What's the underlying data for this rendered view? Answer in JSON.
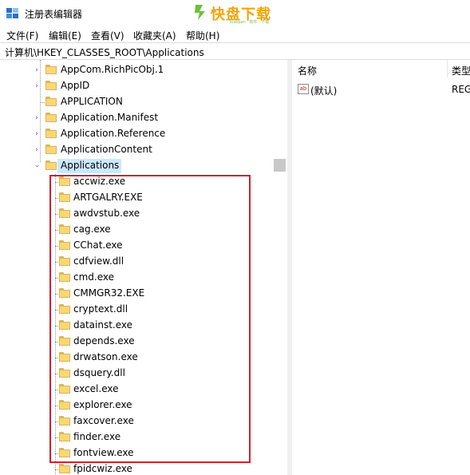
{
  "window": {
    "title": "注册表编辑器",
    "app_icon": "registry-editor-icon"
  },
  "watermark": {
    "text": "快盘下载",
    "subtitle": "kuaipan · 软件 · 下载"
  },
  "menu": [
    {
      "label": "文件(F)"
    },
    {
      "label": "编辑(E)"
    },
    {
      "label": "查看(V)"
    },
    {
      "label": "收藏夹(A)"
    },
    {
      "label": "帮助(H)"
    }
  ],
  "address": {
    "path": "计算机\\HKEY_CLASSES_ROOT\\Applications"
  },
  "tree": {
    "siblings": [
      {
        "label": "AppCom.RichPicObj.1",
        "expandable": true
      },
      {
        "label": "AppID",
        "expandable": true
      },
      {
        "label": "APPLICATION",
        "expandable": false
      },
      {
        "label": "Application.Manifest",
        "expandable": true
      },
      {
        "label": "Application.Reference",
        "expandable": true
      },
      {
        "label": "ApplicationContent",
        "expandable": true
      },
      {
        "label": "Applications",
        "expandable": true,
        "expanded": true,
        "selected": true
      }
    ],
    "children": [
      "accwiz.exe",
      "ARTGALRY.EXE",
      "awdvstub.exe",
      "cag.exe",
      "CChat.exe",
      "cdfview.dll",
      "cmd.exe",
      "CMMGR32.EXE",
      "cryptext.dll",
      "datainst.exe",
      "depends.exe",
      "drwatson.exe",
      "dsquery.dll",
      "excel.exe",
      "explorer.exe",
      "faxcover.exe",
      "finder.exe",
      "fontview.exe",
      "fpidcwiz.exe"
    ]
  },
  "values_pane": {
    "columns": {
      "name": "名称",
      "type": "类型"
    },
    "rows": [
      {
        "name": "(默认)",
        "type": "REG",
        "icon": "string-value-icon"
      }
    ]
  },
  "colors": {
    "selection": "#cce8ff",
    "highlight_border": "#d2202a",
    "folder": "#f8d775"
  }
}
